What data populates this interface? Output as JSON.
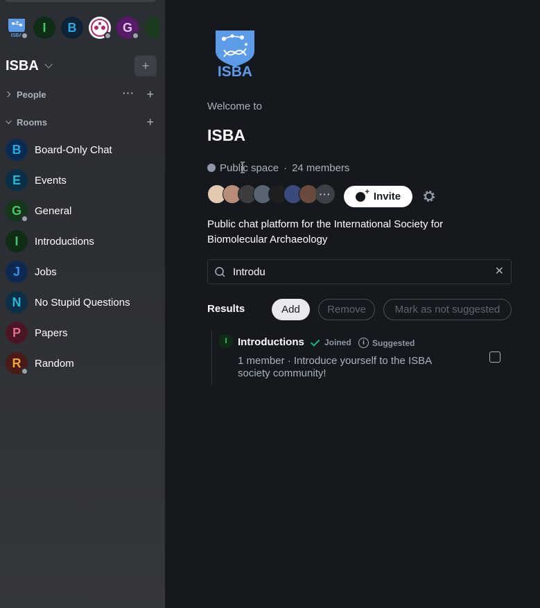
{
  "sidebar": {
    "spaces": [
      {
        "letter": "ISBA",
        "kind": "logo"
      },
      {
        "letter": "I",
        "color": "#4cc56a",
        "bg": "#0f2c14"
      },
      {
        "letter": "B",
        "color": "#29a9e0",
        "bg": "#0c2336"
      },
      {
        "letter": "",
        "kind": "photo"
      },
      {
        "letter": "G",
        "color": "#e0c6f0",
        "bg": "#5a1a6a"
      },
      {
        "letter": "",
        "kind": "partial"
      }
    ],
    "space_title": "ISBA",
    "sections": {
      "people": "People",
      "rooms": "Rooms"
    },
    "rooms": [
      {
        "letter": "B",
        "name": "Board-Only Chat",
        "color": "#29a9e0",
        "bg": "#0c2b52"
      },
      {
        "letter": "E",
        "name": "Events",
        "color": "#29b6d6",
        "bg": "#0b2f46"
      },
      {
        "letter": "G",
        "name": "General",
        "color": "#4cc56a",
        "bg": "#16361a"
      },
      {
        "letter": "I",
        "name": "Introductions",
        "color": "#4cc56a",
        "bg": "#0f2c14"
      },
      {
        "letter": "J",
        "name": "Jobs",
        "color": "#3d8de0",
        "bg": "#0f2a52"
      },
      {
        "letter": "N",
        "name": "No Stupid Questions",
        "color": "#29b6d6",
        "bg": "#0b2f46"
      },
      {
        "letter": "P",
        "name": "Papers",
        "color": "#e06d8f",
        "bg": "#4a1525"
      },
      {
        "letter": "R",
        "name": "Random",
        "color": "#f0a53c",
        "bg": "#4a1a16"
      }
    ]
  },
  "main": {
    "logo_text": "ISBA",
    "welcome": "Welcome to",
    "space_name": "ISBA",
    "visibility": "Public space",
    "members": "24 members",
    "invite_label": "Invite",
    "more_members": "···",
    "description": "Public chat platform for the International Society for Biomolecular Archaeology",
    "search": {
      "value": "Introdu",
      "placeholder": ""
    },
    "results_label": "Results",
    "actions": {
      "add": "Add",
      "remove": "Remove",
      "mark": "Mark as not suggested"
    },
    "result": {
      "letter": "I",
      "name": "Introductions",
      "joined": "Joined",
      "suggested": "Suggested",
      "description": "1 member · Introduce yourself to the ISBA society community!"
    }
  },
  "colors": {
    "sidebar_bg": "#2b2e33",
    "main_bg": "#15191e",
    "accent_green": "#0dbd8b"
  }
}
